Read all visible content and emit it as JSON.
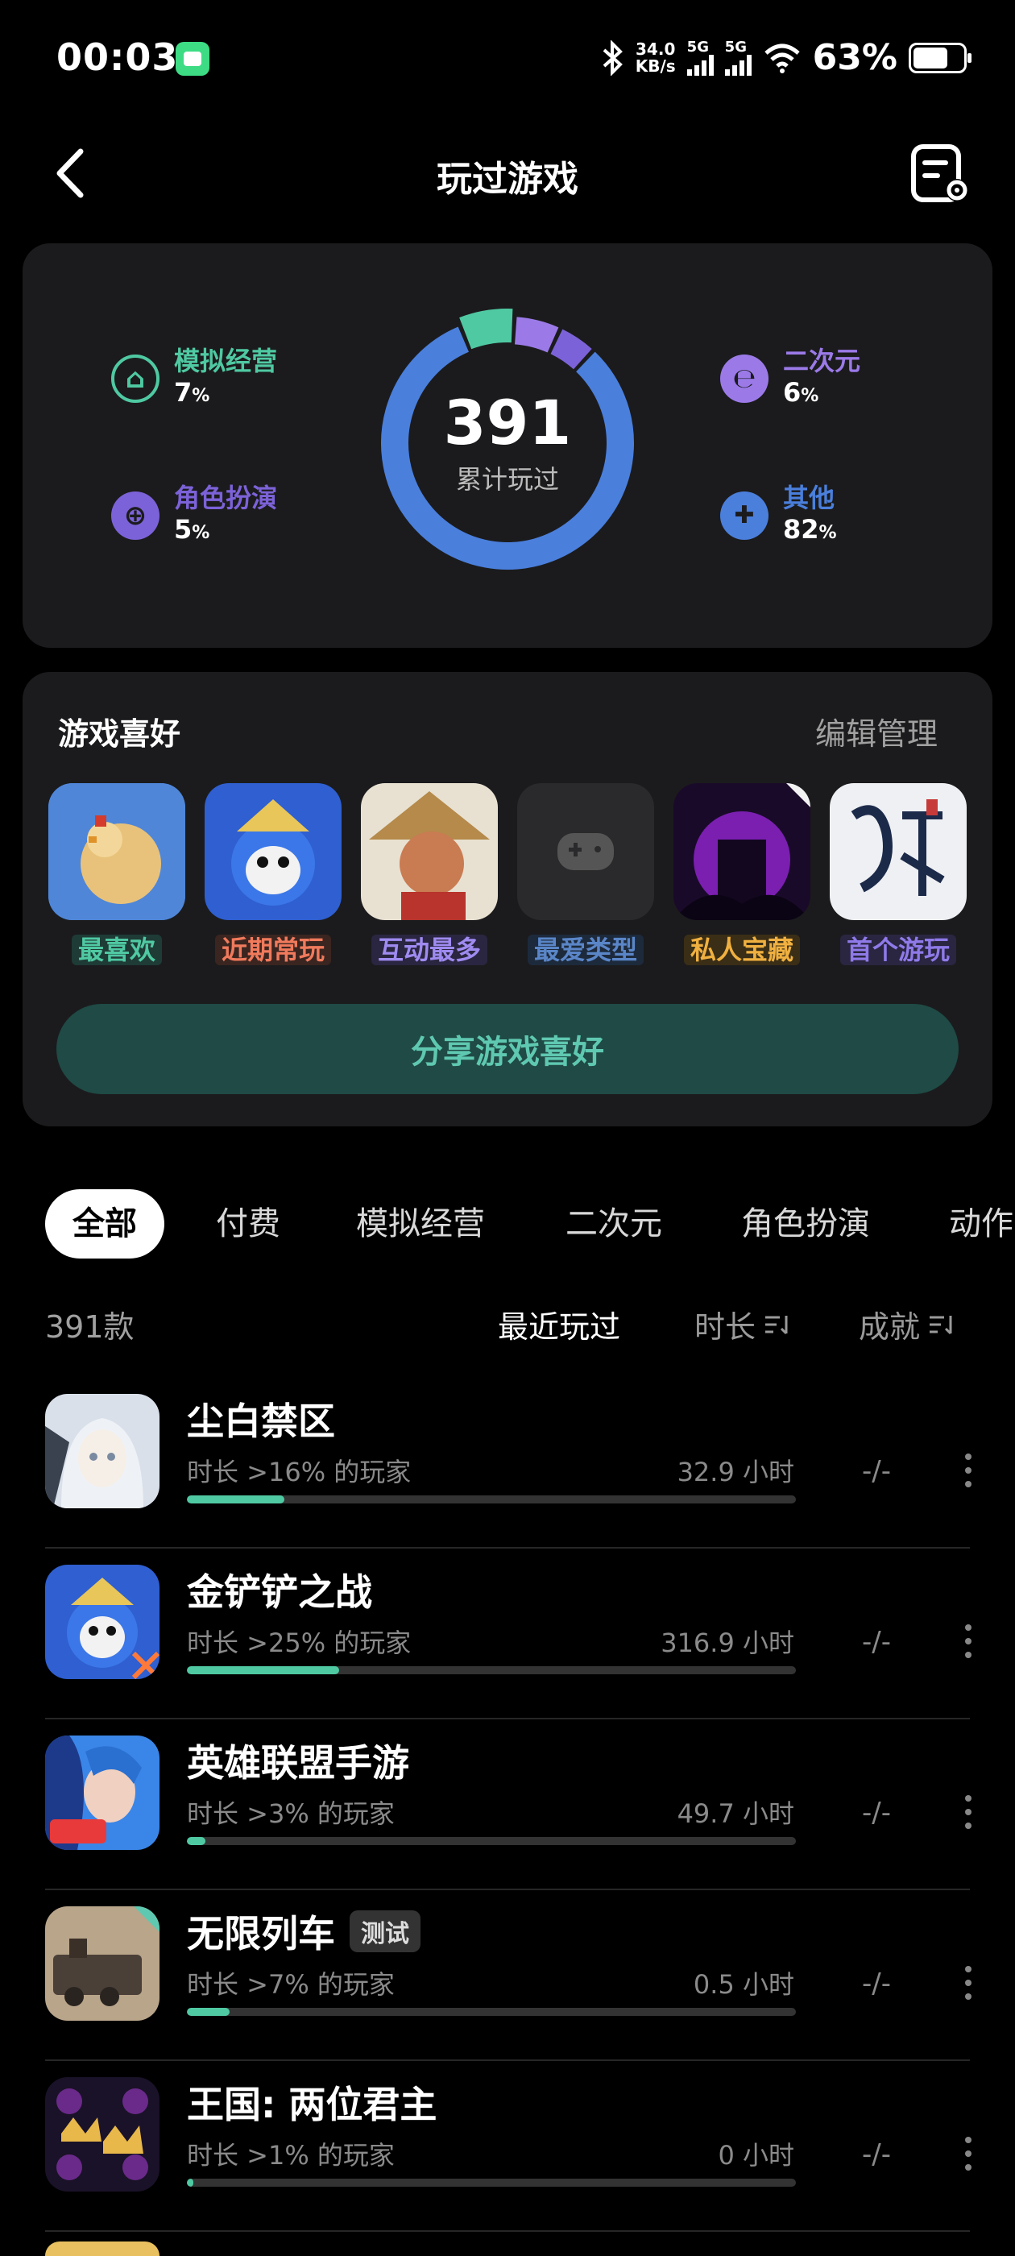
{
  "status_bar": {
    "time": "00:03",
    "speed_value": "34.0",
    "speed_unit": "KB/s",
    "sig1": "5G",
    "sig2": "5G",
    "battery": "63%"
  },
  "header": {
    "title": "玩过游戏"
  },
  "stats": {
    "total": "391",
    "total_label": "累计玩过",
    "categories": [
      {
        "name": "模拟经营",
        "pct": "7",
        "unit": "%",
        "color": "#4fc9a2"
      },
      {
        "name": "角色扮演",
        "pct": "5",
        "unit": "%",
        "color": "#7c62d8"
      },
      {
        "name": "二次元",
        "pct": "6",
        "unit": "%",
        "color": "#9b7ae8"
      },
      {
        "name": "其他",
        "pct": "82",
        "unit": "%",
        "color": "#4a7fdc"
      }
    ]
  },
  "favorites": {
    "title": "游戏喜好",
    "edit": "编辑管理",
    "items": [
      {
        "label": "最喜欢",
        "color": "#4fc9a2",
        "bg": "#1f3b36"
      },
      {
        "label": "近期常玩",
        "color": "#f07a5c",
        "bg": "#3b2520"
      },
      {
        "label": "互动最多",
        "color": "#9f8bf0",
        "bg": "#2a2540"
      },
      {
        "label": "最爱类型",
        "color": "#5a86c8",
        "bg": "#1d2a3c"
      },
      {
        "label": "私人宝藏",
        "color": "#f0b040",
        "bg": "#3a2e16"
      },
      {
        "label": "首个游玩",
        "color": "#8f7ae8",
        "bg": "#2a2540"
      }
    ],
    "share": "分享游戏喜好"
  },
  "tabs": [
    "全部",
    "付费",
    "模拟经营",
    "二次元",
    "角色扮演",
    "动作"
  ],
  "list": {
    "count": "391款",
    "sort": [
      "最近玩过",
      "时长",
      "成就"
    ],
    "games": [
      {
        "name": "尘白禁区",
        "badge": "",
        "sub": "时长 >16% 的玩家",
        "hours": "32.9 小时",
        "ach": "-/-",
        "progress": 0.16
      },
      {
        "name": "金铲铲之战",
        "badge": "",
        "sub": "时长 >25% 的玩家",
        "hours": "316.9 小时",
        "ach": "-/-",
        "progress": 0.25
      },
      {
        "name": "英雄联盟手游",
        "badge": "",
        "sub": "时长 >3% 的玩家",
        "hours": "49.7 小时",
        "ach": "-/-",
        "progress": 0.03
      },
      {
        "name": "无限列车",
        "badge": "测试",
        "sub": "时长 >7% 的玩家",
        "hours": "0.5 小时",
        "ach": "-/-",
        "progress": 0.07
      },
      {
        "name": "王国: 两位君主",
        "badge": "",
        "sub": "时长 >1% 的玩家",
        "hours": "0 小时",
        "ach": "-/-",
        "progress": 0.01
      }
    ]
  }
}
